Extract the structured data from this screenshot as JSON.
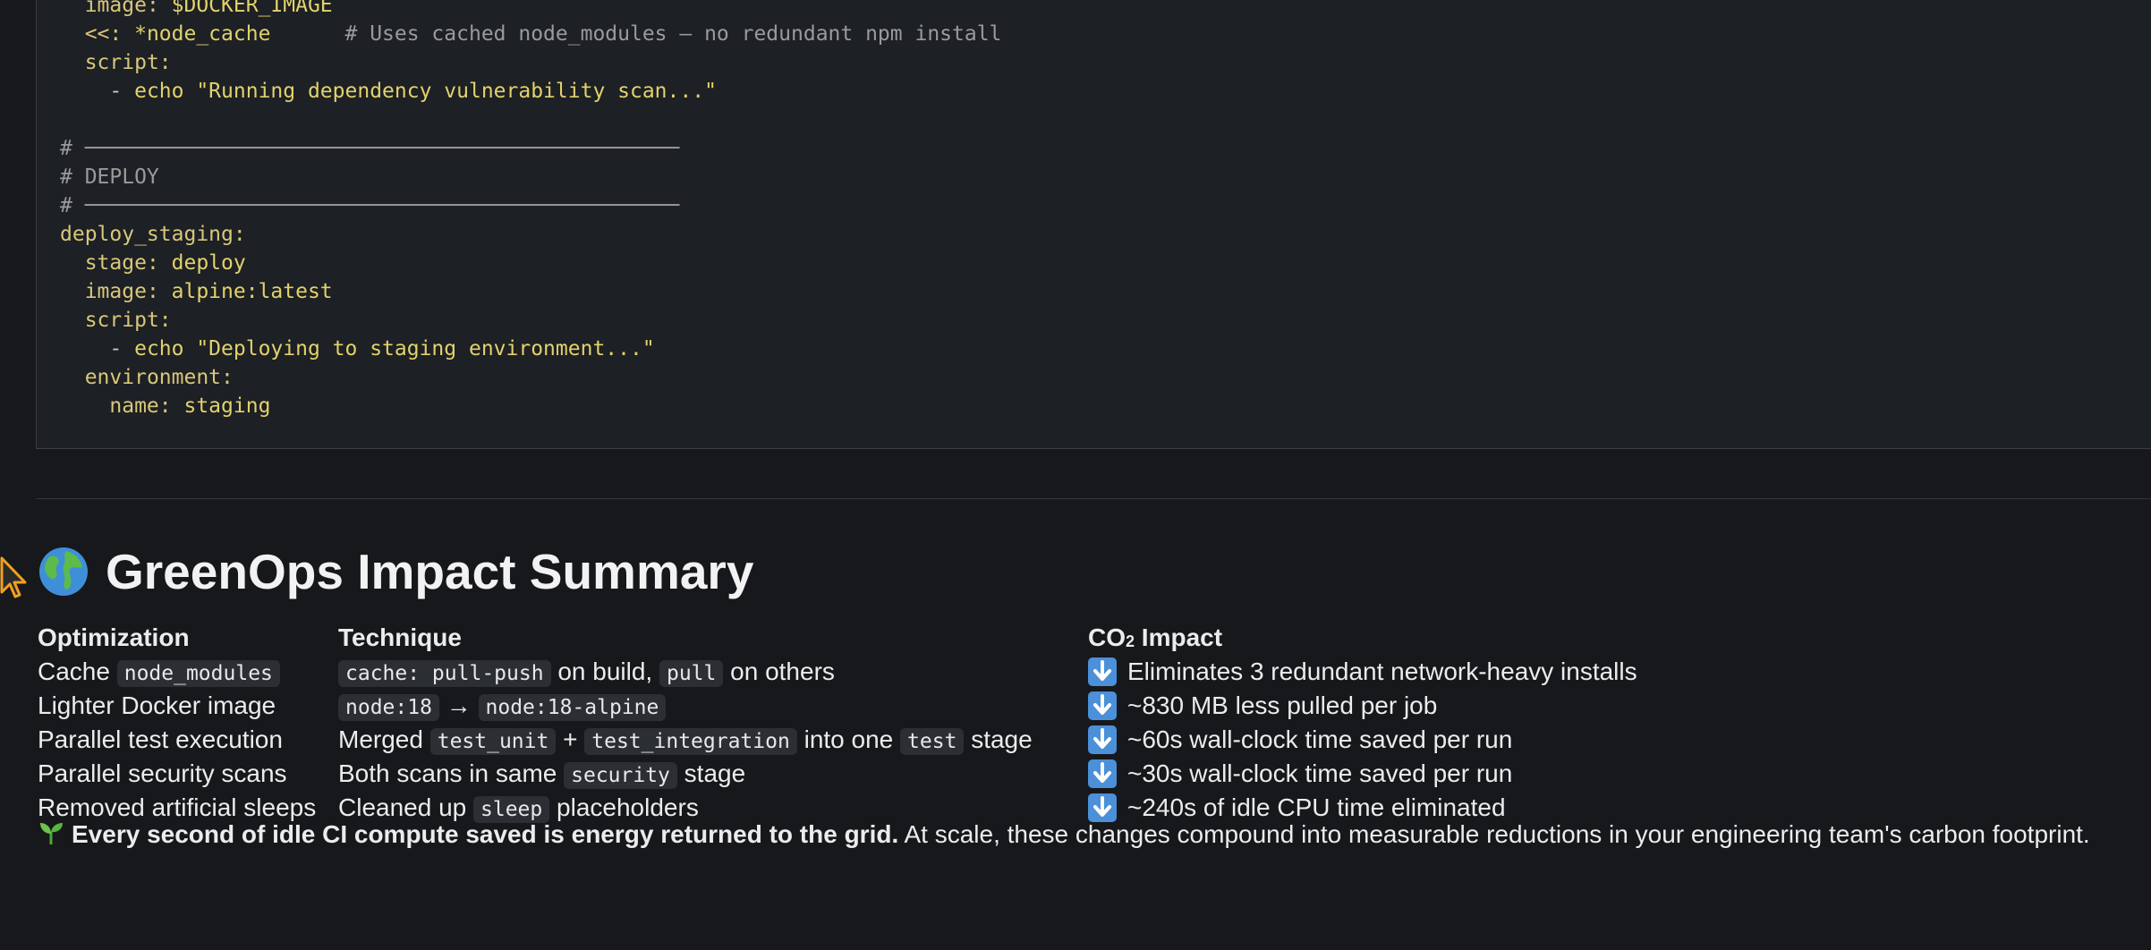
{
  "code_lines": [
    [
      "  ",
      "image:",
      " $DOCKER_IMAGE"
    ],
    [
      "  ",
      "<<:",
      " *node_cache      ",
      "# Uses cached node_modules — no redundant npm install"
    ],
    [
      "  ",
      "script:"
    ],
    [
      "    - ",
      "echo \"Running dependency vulnerability scan...\""
    ],
    [
      ""
    ],
    [
      "# ────────────────────────────────────────────────"
    ],
    [
      "# DEPLOY"
    ],
    [
      "# ────────────────────────────────────────────────"
    ],
    [
      "",
      "deploy_staging:"
    ],
    [
      "  ",
      "stage:",
      " deploy"
    ],
    [
      "  ",
      "image:",
      " alpine:latest"
    ],
    [
      "  ",
      "script:"
    ],
    [
      "    - ",
      "echo \"Deploying to staging environment...\""
    ],
    [
      "  ",
      "environment:"
    ],
    [
      "    ",
      "name:",
      " staging"
    ]
  ],
  "summary": {
    "title": "GreenOps Impact Summary",
    "headers": {
      "optimization": "Optimization",
      "technique": "Technique",
      "impact_prefix": "CO",
      "impact_sub": "2",
      "impact_suffix": " Impact"
    },
    "rows": [
      {
        "optimization": "Cache",
        "optimization_code": "node_modules",
        "technique": [
          [
            "code",
            "cache: pull-push"
          ],
          [
            "text",
            " on build, "
          ],
          [
            "code",
            "pull"
          ],
          [
            "text",
            " on others"
          ]
        ],
        "impact": "Eliminates 3 redundant network-heavy installs"
      },
      {
        "optimization": "Lighter Docker image",
        "optimization_code": "",
        "technique": [
          [
            "code",
            "node:18"
          ],
          [
            "text",
            " → "
          ],
          [
            "code",
            "node:18-alpine"
          ]
        ],
        "impact": "~830 MB less pulled per job"
      },
      {
        "optimization": "Parallel test execution",
        "optimization_code": "",
        "technique": [
          [
            "text",
            "Merged "
          ],
          [
            "code",
            "test_unit"
          ],
          [
            "text",
            " + "
          ],
          [
            "code",
            "test_integration"
          ],
          [
            "text",
            " into one "
          ],
          [
            "code",
            "test"
          ],
          [
            "text",
            " stage"
          ]
        ],
        "impact": "~60s wall-clock time saved per run"
      },
      {
        "optimization": "Parallel security scans",
        "optimization_code": "",
        "technique": [
          [
            "text",
            "Both scans in same "
          ],
          [
            "code",
            "security"
          ],
          [
            "text",
            " stage"
          ]
        ],
        "impact": "~30s wall-clock time saved per run"
      },
      {
        "optimization": "Removed artificial sleeps",
        "optimization_code": "",
        "technique": [
          [
            "text",
            "Cleaned up "
          ],
          [
            "code",
            "sleep"
          ],
          [
            "text",
            " placeholders"
          ]
        ],
        "impact": "~240s of idle CPU time eliminated"
      }
    ],
    "footer_bold": "Every second of idle CI compute saved is energy returned to the grid.",
    "footer_rest": " At scale, these changes compound into measurable reductions in your engineering team's carbon footprint."
  },
  "icons": {
    "heading": "globe-icon",
    "impact": "down-arrow-icon",
    "footer": "sprout-icon",
    "cursor": "mouse-cursor-icon"
  },
  "colors": {
    "background": "#16181c",
    "code_bg": "#1d2024",
    "key": "#d8c77a",
    "value": "#e2d26b",
    "comment": "#9a9a9a",
    "arrow_badge": "#4b90d8"
  }
}
